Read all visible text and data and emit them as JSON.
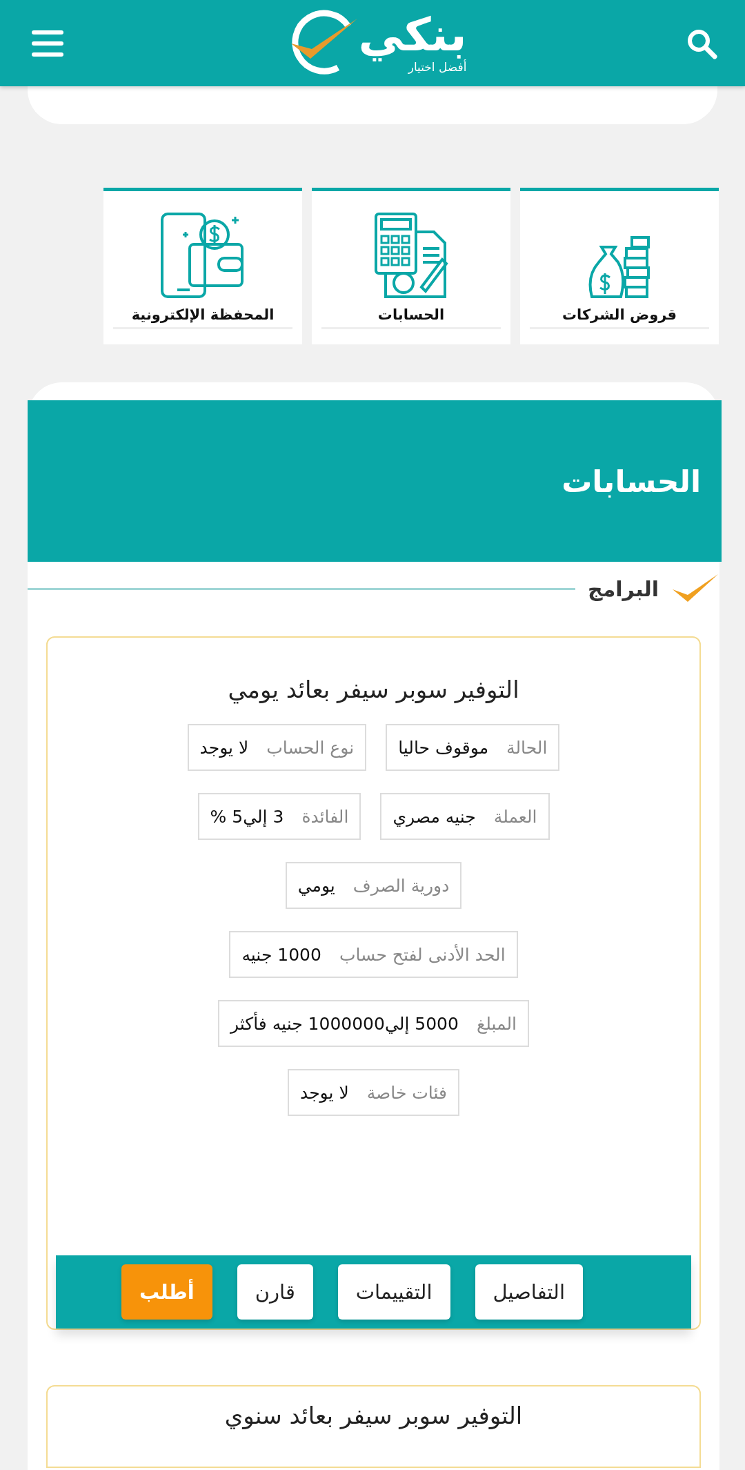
{
  "header": {
    "logo_text": "بنكي",
    "logo_tagline": "أفضل اختيار"
  },
  "categories": [
    {
      "label": "قروض الشركات",
      "kind": "loans"
    },
    {
      "label": "الحسابات",
      "kind": "accounts"
    },
    {
      "label": "المحفظة الإلكترونية",
      "kind": "wallet"
    }
  ],
  "section": {
    "title": "الحسابات",
    "subheading": "البرامج"
  },
  "programs": [
    {
      "title": "التوفير سوبر سيفر بعائد يومي",
      "field_rows": [
        {
          "fields": [
            {
              "label": "الحالة",
              "value": "موقوف حاليا"
            },
            {
              "label": "نوع الحساب",
              "value": "لا يوجد"
            }
          ]
        },
        {
          "fields": [
            {
              "label": "العملة",
              "value": "جنيه مصري"
            },
            {
              "label": "الفائدة",
              "value": "3 إلي5 %"
            }
          ]
        },
        {
          "fields": [
            {
              "label": "دورية الصرف",
              "value": "يومي"
            }
          ]
        },
        {
          "fields": [
            {
              "label": "الحد الأدنى لفتح حساب",
              "value": "1000 جنيه"
            }
          ]
        },
        {
          "fields": [
            {
              "label": "المبلغ",
              "value": "5000 إلي1000000 جنيه فأكثر"
            }
          ]
        },
        {
          "fields": [
            {
              "label": "فئات خاصة",
              "value": "لا يوجد"
            }
          ]
        }
      ],
      "buttons": [
        {
          "label": "التفاصيل",
          "kind": "secondary"
        },
        {
          "label": "التقييمات",
          "kind": "secondary"
        },
        {
          "label": "قارن",
          "kind": "secondary"
        },
        {
          "label": "أطلب",
          "kind": "primary"
        }
      ]
    },
    {
      "title": "التوفير سوبر سيفر بعائد سنوي"
    }
  ]
}
